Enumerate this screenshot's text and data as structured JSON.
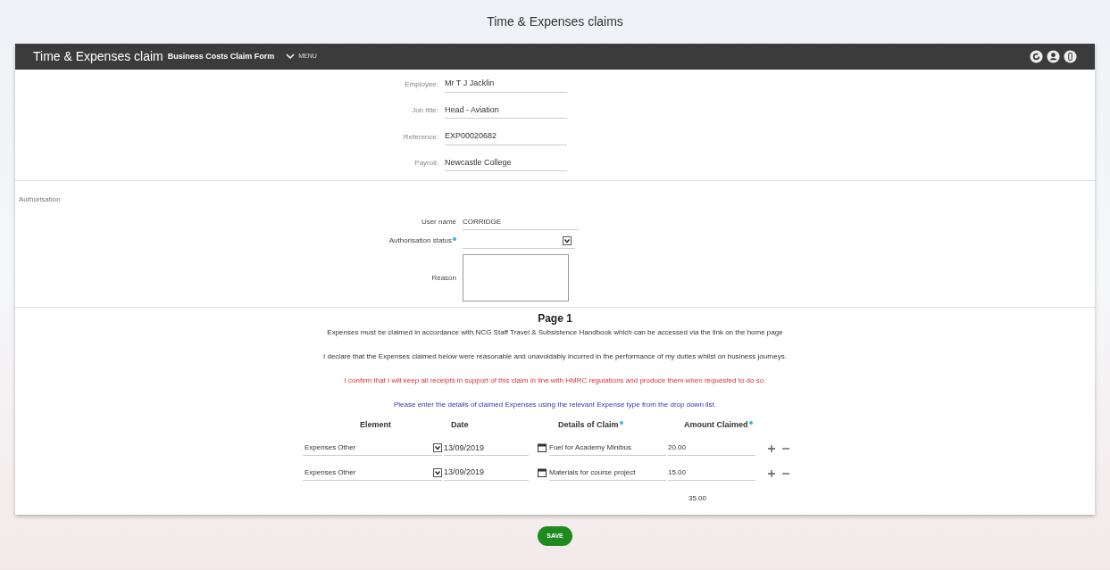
{
  "page_title": "Time & Expenses claims",
  "header": {
    "title": "Time & Expenses claim",
    "subtitle": "Business Costs Claim Form",
    "menu": "MENU"
  },
  "details": [
    {
      "label": "Employee:",
      "value": "Mr T J Jacklin"
    },
    {
      "label": "Job title:",
      "value": "Head - Aviation"
    },
    {
      "label": "Reference:",
      "value": "EXP00020682"
    },
    {
      "label": "Payroll:",
      "value": "Newcastle College"
    }
  ],
  "authorisation": {
    "heading": "Authorisation",
    "user_name_label": "User name",
    "user_name": "CORRIDGE",
    "status_label": "Authorisation status",
    "status_required": true,
    "reason_label": "Reason"
  },
  "page_heading": "Page 1",
  "notices": [
    {
      "text": "Expenses must be claimed in accordance with NCG Staff Travel & Subsistence Handbook which can be accessed via the link on the home page",
      "kind": "plain"
    },
    {
      "text": "I declare that the Expenses claimed below were reasonable and unavoidably incurred in the performance of my duties whilst on business journeys.",
      "kind": "plain"
    },
    {
      "text": "I confirm that I will keep all receipts in support of this claim in line with HMRC regulations and produce them when requested to do so.",
      "kind": "warning"
    },
    {
      "text": "Please enter the details of claimed Expenses using the relevant Expense type from the drop down list.",
      "kind": "instruction"
    }
  ],
  "table": {
    "columns": [
      {
        "label": "Element",
        "required": false
      },
      {
        "label": "Date",
        "required": false
      },
      {
        "label": "Details of Claim",
        "required": true
      },
      {
        "label": "Amount Claimed",
        "required": true
      }
    ],
    "rows": [
      {
        "element": "Expenses Other",
        "date": "13/09/2019",
        "details": "Fuel for Academy Minibus",
        "amount": "20.00"
      },
      {
        "element": "Expenses Other",
        "date": "13/09/2019",
        "details": "Materials for course project",
        "amount": "15.00"
      }
    ],
    "total": "35.00"
  },
  "save_button": "SAVE"
}
